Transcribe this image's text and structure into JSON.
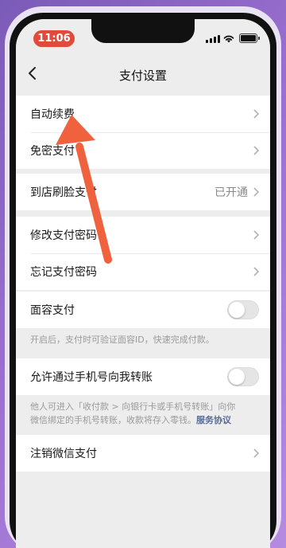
{
  "status_bar": {
    "time": "11:06"
  },
  "nav": {
    "title": "支付设置"
  },
  "rows": {
    "auto_renew": {
      "label": "自动续费"
    },
    "password_free": {
      "label": "免密支付"
    },
    "face_pay_store": {
      "label": "到店刷脸支付",
      "value": "已开通"
    },
    "change_password": {
      "label": "修改支付密码"
    },
    "forgot_password": {
      "label": "忘记支付密码"
    },
    "face_id_pay": {
      "label": "面容支付",
      "enabled": false
    },
    "phone_transfer": {
      "label": "允许通过手机号向我转账",
      "enabled": false
    },
    "deregister": {
      "label": "注销微信支付"
    }
  },
  "notes": {
    "face_id": "开启后，支付时可验证面容ID，快速完成付款。",
    "phone_transfer_line1": "他人可进入「收付款 > 向银行卡或手机号转账」向你",
    "phone_transfer_line2": "微信绑定的手机号转账，收款将存入零钱。",
    "service_link": "服务协议"
  },
  "colors": {
    "time_pill": "#e24b3b",
    "annotation_arrow": "#f0623e",
    "link": "#576b95"
  }
}
